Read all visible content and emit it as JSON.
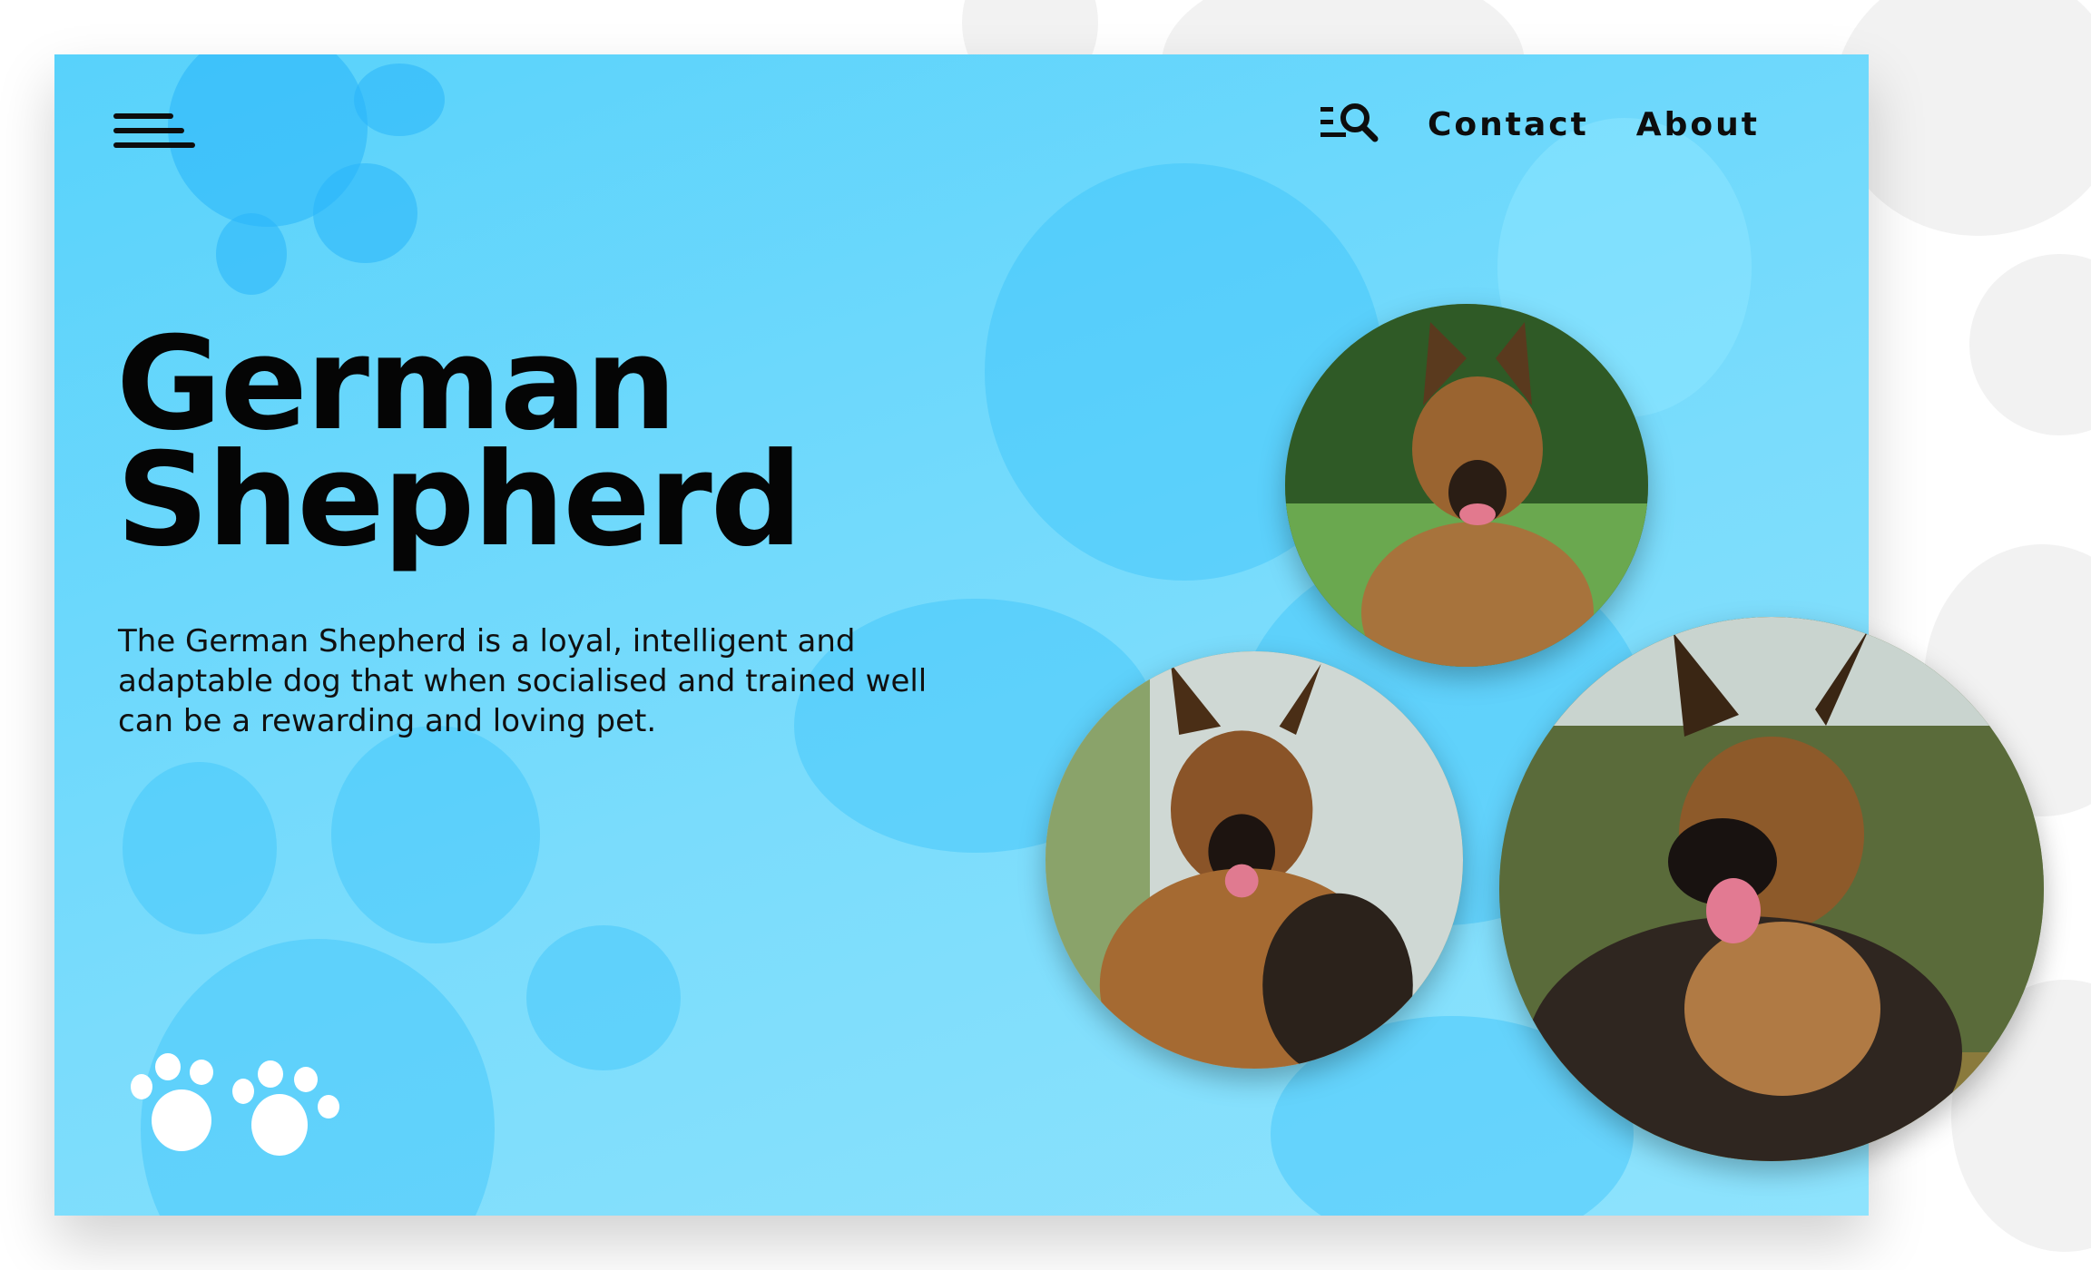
{
  "nav": {
    "search_icon": "search-list-icon",
    "links": [
      {
        "label": "Contact"
      },
      {
        "label": "About"
      }
    ]
  },
  "hero": {
    "title_line1": "German",
    "title_line2": "Shepherd",
    "description": "The German Shepherd is a loyal, intelligent and adaptable dog that when socialised and trained well can be a rewarding and loving pet."
  },
  "icons": {
    "menu": "hamburger-menu-icon",
    "paws": "paw-prints-icon"
  },
  "colors": {
    "background": "#58d2fb",
    "text": "#050505",
    "paw": "#ffffff"
  }
}
